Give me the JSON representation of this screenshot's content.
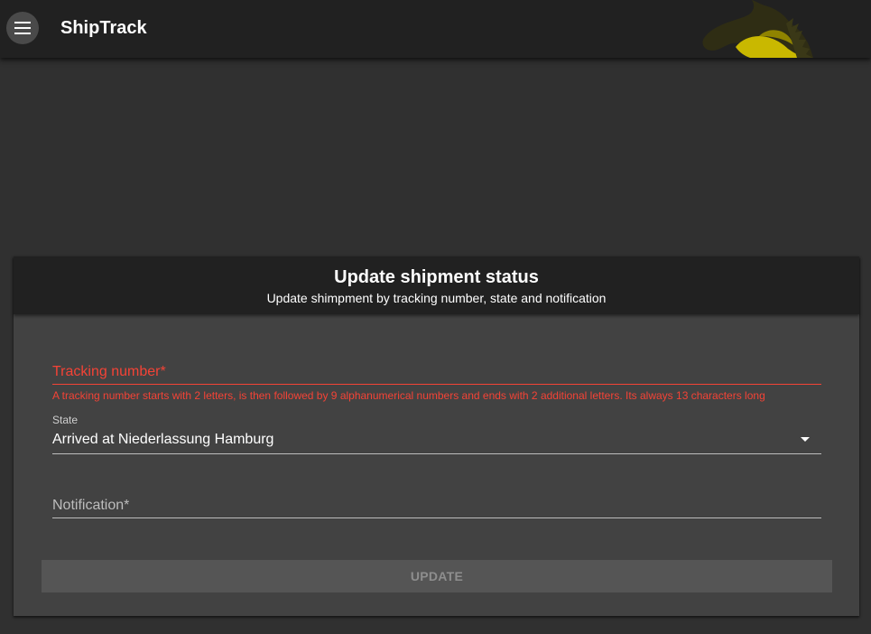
{
  "app": {
    "title": "ShipTrack",
    "menu_icon": "menu-icon",
    "logo_icon": "horse-head-logo"
  },
  "form": {
    "title": "Update shipment status",
    "subtitle": "Update shimpment by tracking number, state and notification",
    "tracking": {
      "label": "Tracking number*",
      "value": "",
      "error": "A tracking number starts with 2 letters, is then followed by 9 alphanumerical numbers and ends with 2 additional letters. Its always 13 characters long"
    },
    "state": {
      "label": "State",
      "selected": "Arrived at Niederlassung Hamburg"
    },
    "notification": {
      "label": "Notification*",
      "value": ""
    },
    "submit_label": "UPDATE"
  },
  "colors": {
    "background": "#303030",
    "appbar": "#212121",
    "card": "#424242",
    "error": "#f44336",
    "logo": "#c9b800"
  }
}
